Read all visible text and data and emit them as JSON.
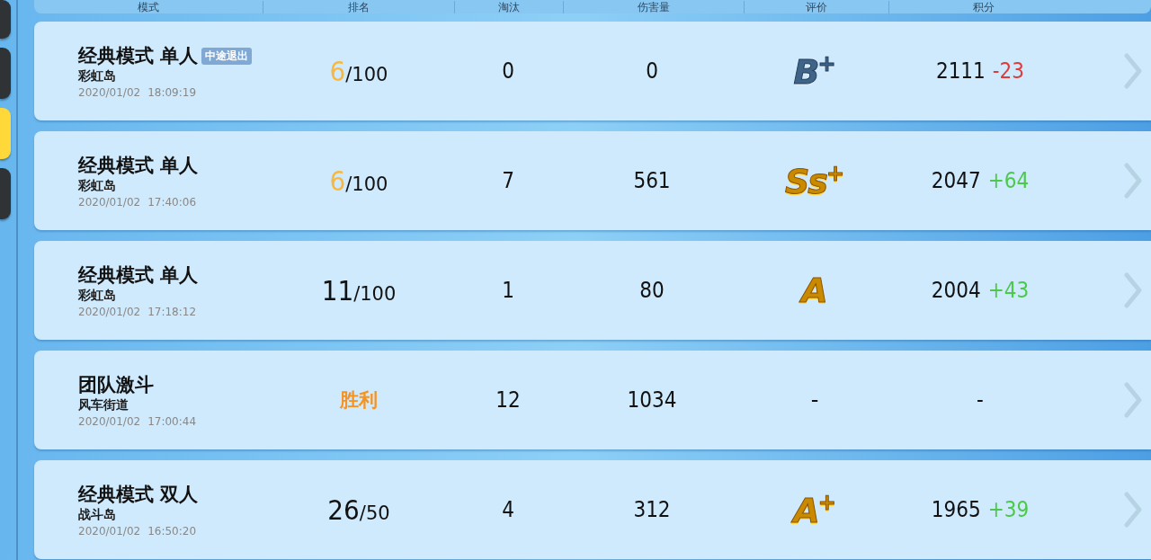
{
  "side_tabs": [
    {
      "selected": false
    },
    {
      "selected": false
    },
    {
      "selected": true
    },
    {
      "selected": false
    }
  ],
  "columns": [
    "模式",
    "排名",
    "淘汰",
    "伤害量",
    "评价",
    "积分"
  ],
  "rows": [
    {
      "mode": "经典模式 单人",
      "badge": "中途退出",
      "map": "彩虹岛",
      "date": "2020/01/02",
      "time": "18:09:19",
      "rank": {
        "kind": "place",
        "place": "6",
        "total": "/100",
        "top": true
      },
      "eliminations": "0",
      "damage": "0",
      "grade": {
        "kind": "badge",
        "letter": "B",
        "mark": "+",
        "gold": false
      },
      "score": {
        "value": "2111",
        "delta": "-23",
        "gain": false
      }
    },
    {
      "mode": "经典模式 单人",
      "map": "彩虹岛",
      "date": "2020/01/02",
      "time": "17:40:06",
      "rank": {
        "kind": "place",
        "place": "6",
        "total": "/100",
        "top": true
      },
      "eliminations": "7",
      "damage": "561",
      "grade": {
        "kind": "badge",
        "letter": "Ss",
        "mark": "+",
        "gold": true
      },
      "score": {
        "value": "2047",
        "delta": "+64",
        "gain": true
      }
    },
    {
      "mode": "经典模式 单人",
      "map": "彩虹岛",
      "date": "2020/01/02",
      "time": "17:18:12",
      "rank": {
        "kind": "place",
        "place": "11",
        "total": "/100",
        "top": false
      },
      "eliminations": "1",
      "damage": "80",
      "grade": {
        "kind": "badge",
        "letter": "A",
        "gold": true
      },
      "score": {
        "value": "2004",
        "delta": "+43",
        "gain": true
      }
    },
    {
      "mode": "团队激斗",
      "map": "风车街道",
      "date": "2020/01/02",
      "time": "17:00:44",
      "rank": {
        "kind": "result",
        "text": "胜利"
      },
      "eliminations": "12",
      "damage": "1034",
      "grade": {
        "kind": "none",
        "letter": "-"
      },
      "score": {
        "value": "-"
      }
    },
    {
      "mode": "经典模式 双人",
      "map": "战斗岛",
      "date": "2020/01/02",
      "time": "16:50:20",
      "rank": {
        "kind": "place",
        "place": "26",
        "total": "/50",
        "top": false
      },
      "eliminations": "4",
      "damage": "312",
      "grade": {
        "kind": "badge",
        "letter": "A",
        "mark": "+",
        "gold": true
      },
      "score": {
        "value": "1965",
        "delta": "+39",
        "gain": true
      }
    }
  ]
}
